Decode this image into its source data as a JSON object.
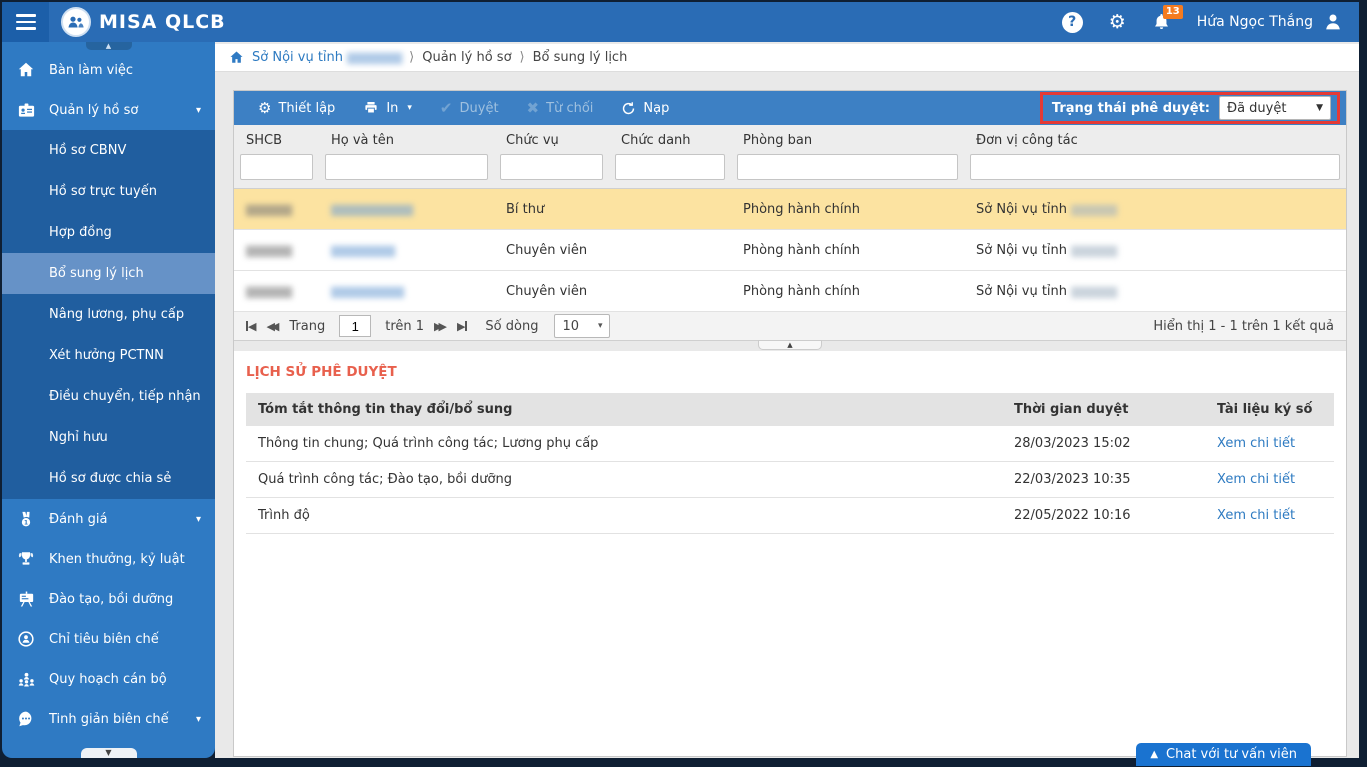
{
  "glyphs": {
    "gear": "⚙",
    "check": "✔",
    "x": "✖",
    "caret_down": "▼",
    "caret_small": "▾",
    "crumb_sep": "⟩",
    "first": "◀",
    "prev": "◀◀",
    "next": "▶▶",
    "last": "▶",
    "up_triangle": "▲",
    "question": "?",
    "tab_up": "▲",
    "tab_down": "▼"
  },
  "topbar": {
    "logo_text": "MISA QLCB",
    "notification_badge": "13",
    "user_name": "Hứa Ngọc Thắng"
  },
  "breadcrumb": {
    "root_label": "Sở Nội vụ tỉnh",
    "root_redacted": "▆▆▆▆▆▆",
    "level2": "Quản lý hồ sơ",
    "level3": "Bổ sung lý lịch"
  },
  "sidebar": {
    "items_top": [
      {
        "label": "Bàn làm việc"
      },
      {
        "label": "Quản lý hồ sơ"
      }
    ],
    "submenu": [
      {
        "label": "Hồ sơ CBNV"
      },
      {
        "label": "Hồ sơ trực tuyến"
      },
      {
        "label": "Hợp đồng"
      },
      {
        "label": "Bổ sung lý lịch"
      },
      {
        "label": "Nâng lương, phụ cấp"
      },
      {
        "label": "Xét hưởng PCTNN"
      },
      {
        "label": "Điều chuyển, tiếp nhận"
      },
      {
        "label": "Nghỉ hưu"
      },
      {
        "label": "Hồ sơ được chia sẻ"
      }
    ],
    "items_lower": [
      {
        "label": "Đánh giá"
      },
      {
        "label": "Khen thưởng, kỷ luật"
      },
      {
        "label": "Đào tạo, bồi dưỡng"
      },
      {
        "label": "Chỉ tiêu biên chế"
      },
      {
        "label": "Quy hoạch cán bộ"
      },
      {
        "label": "Tinh giản biên chế"
      }
    ]
  },
  "toolbar": {
    "settings": "Thiết lập",
    "print": "In",
    "approve": "Duyệt",
    "reject": "Từ chối",
    "reload": "Nạp",
    "status_filter_label": "Trạng thái phê duyệt:",
    "status_filter_value": "Đã duyệt"
  },
  "table": {
    "columns": [
      "SHCB",
      "Họ và tên",
      "Chức vụ",
      "Chức danh",
      "Phòng ban",
      "Đơn vị công tác"
    ],
    "rows": [
      {
        "shcb_redacted": "▆▆▆▆▆",
        "name_redacted": "▆▆▆▆▆▆▆▆▆",
        "chuc_vu": "Bí thư",
        "chuc_danh": "",
        "phong_ban": "Phòng hành chính",
        "don_vi_prefix": "Sở Nội vụ tỉnh",
        "don_vi_redacted": "▆▆▆▆▆"
      },
      {
        "shcb_redacted": "▆▆▆▆▆",
        "name_redacted": "▆▆▆▆▆▆▆",
        "chuc_vu": "Chuyên viên",
        "chuc_danh": "",
        "phong_ban": "Phòng hành chính",
        "don_vi_prefix": "Sở Nội vụ tỉnh",
        "don_vi_redacted": "▆▆▆▆▆"
      },
      {
        "shcb_redacted": "▆▆▆▆▆",
        "name_redacted": "▆▆▆▆▆▆▆▆",
        "chuc_vu": "Chuyên viên",
        "chuc_danh": "",
        "phong_ban": "Phòng hành chính",
        "don_vi_prefix": "Sở Nội vụ tỉnh",
        "don_vi_redacted": "▆▆▆▆▆"
      }
    ]
  },
  "pagination": {
    "page_label": "Trang",
    "page_value": "1",
    "of_label": "trên 1",
    "rows_label": "Số dòng",
    "rows_value": "10",
    "summary": "Hiển thị 1 - 1 trên 1 kết quả"
  },
  "history": {
    "title": "LỊCH SỬ PHÊ DUYỆT",
    "columns": [
      "Tóm tắt thông tin thay đổi/bổ sung",
      "Thời gian duyệt",
      "Tài liệu ký số"
    ],
    "rows": [
      {
        "summary": "Thông tin chung; Quá trình công tác; Lương phụ cấp",
        "time": "28/03/2023 15:02",
        "link": "Xem chi tiết"
      },
      {
        "summary": "Quá trình công tác; Đào tạo, bồi dưỡng",
        "time": "22/03/2023 10:35",
        "link": "Xem chi tiết"
      },
      {
        "summary": "Trình độ",
        "time": "22/05/2022 10:16",
        "link": "Xem chi tiết"
      }
    ]
  },
  "chat_button": {
    "label": "Chat với tư vấn viên"
  },
  "colors": {
    "topbar": "#2a6cb5",
    "sidebar": "#2f7ac3",
    "submenu": "#205e9f",
    "submenu_selected": "#6692c7",
    "toolbar": "#3d80c4",
    "selected_row": "#fce3a1",
    "highlight_red": "#e43a36",
    "history_title": "#e8604d",
    "link": "#2d7ac1",
    "badge": "#f47b20",
    "chat": "#1a73d0"
  }
}
